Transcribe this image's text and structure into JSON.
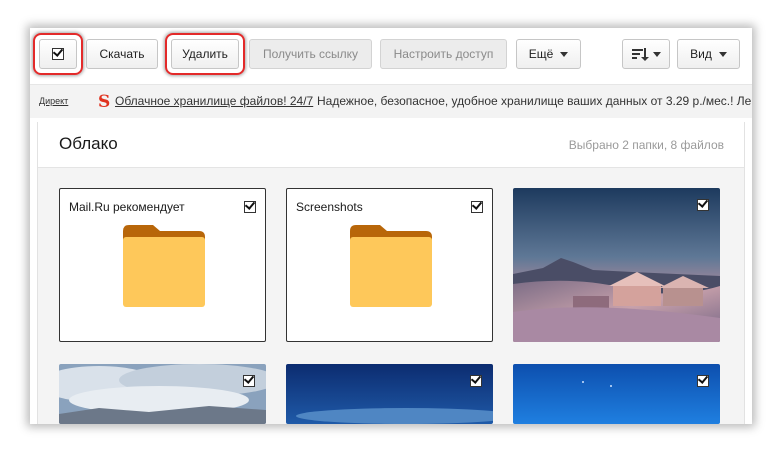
{
  "toolbar": {
    "download_label": "Скачать",
    "delete_label": "Удалить",
    "get_link_label": "Получить ссылку",
    "access_label": "Настроить доступ",
    "more_label": "Ещё",
    "view_label": "Вид"
  },
  "ad": {
    "label": "Директ",
    "link_text": "Облачное хранилище файлов! 24/7",
    "text": "Надежное, безопасное, удобное хранилище ваших данных от 3.29 р./мес.! Ле"
  },
  "content": {
    "title": "Облако",
    "selected_info": "Выбрано 2 папки, 8 файлов",
    "folders": [
      {
        "name": "Mail.Ru рекомендует",
        "checked": true
      },
      {
        "name": "Screenshots",
        "checked": true
      }
    ]
  },
  "colors": {
    "highlight": "#e32a2a",
    "folder_front": "#fec85a",
    "folder_back": "#b86609",
    "ad_logo": "#e0321f"
  },
  "icons": [
    "checkbox-icon",
    "sort-icon",
    "chevron-down-icon",
    "folder-icon",
    "ad-logo-icon"
  ]
}
